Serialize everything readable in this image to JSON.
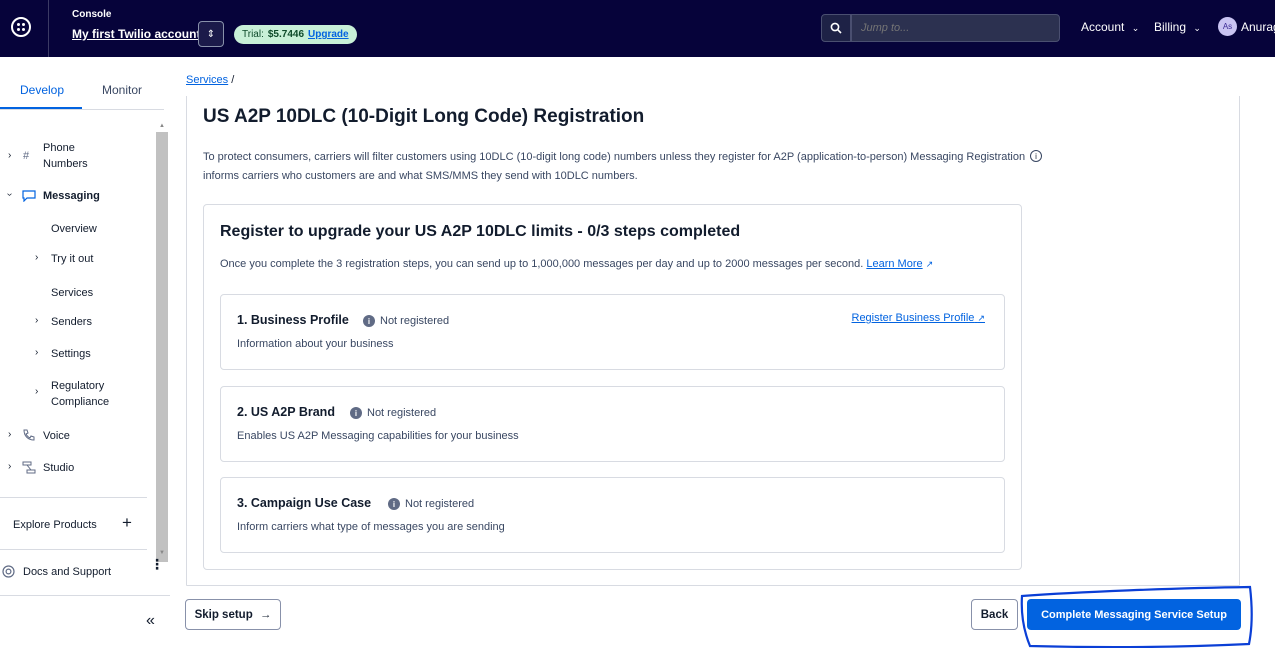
{
  "topbar": {
    "console_label": "Console",
    "account_name": "My first Twilio account",
    "trial_label": "Trial:",
    "trial_amount": "$5.7446",
    "upgrade_label": "Upgrade",
    "search_placeholder": "Jump to...",
    "account_menu": "Account",
    "billing_menu": "Billing",
    "avatar_initials": "As",
    "user_name": "Anurag"
  },
  "sidebar": {
    "tabs": [
      "Develop",
      "Monitor"
    ],
    "items": {
      "phone_numbers": "Phone\nNumbers",
      "messaging": "Messaging",
      "overview": "Overview",
      "try_it_out": "Try it out",
      "services": "Services",
      "senders": "Senders",
      "settings": "Settings",
      "regulatory": "Regulatory\nCompliance",
      "voice": "Voice",
      "studio": "Studio"
    },
    "explore_products": "Explore Products",
    "docs_support": "Docs and Support"
  },
  "main": {
    "breadcrumb_link": "Services",
    "breadcrumb_sep": "/",
    "title": "US A2P 10DLC (10-Digit Long Code) Registration",
    "intro": "To protect consumers, carriers will filter customers using 10DLC (10-digit long code) numbers unless they register for A2P (application-to-person) Messaging Registration informs carriers who customers are and what SMS/MMS they send with 10DLC numbers.",
    "card_title": "Register to upgrade your US A2P 10DLC limits - 0/3 steps completed",
    "card_desc": "Once you complete the 3 registration steps, you can send up to 1,000,000 messages per day and up to 2000 messages per second.",
    "learn_more": "Learn More",
    "steps": [
      {
        "title": "1. Business Profile",
        "status": "Not registered",
        "desc": "Information about your business",
        "link": "Register Business Profile"
      },
      {
        "title": "2. US A2P Brand",
        "status": "Not registered",
        "desc": "Enables US A2P Messaging capabilities for your business"
      },
      {
        "title": "3. Campaign Use Case",
        "status": "Not registered",
        "desc": "Inform carriers what type of messages you are sending"
      }
    ]
  },
  "footer": {
    "skip_label": "Skip setup",
    "back_label": "Back",
    "complete_label": "Complete Messaging Service Setup"
  },
  "colors": {
    "topbar_bg": "#06033a",
    "accent": "#0263e0",
    "annotation": "#0b3fd6"
  }
}
